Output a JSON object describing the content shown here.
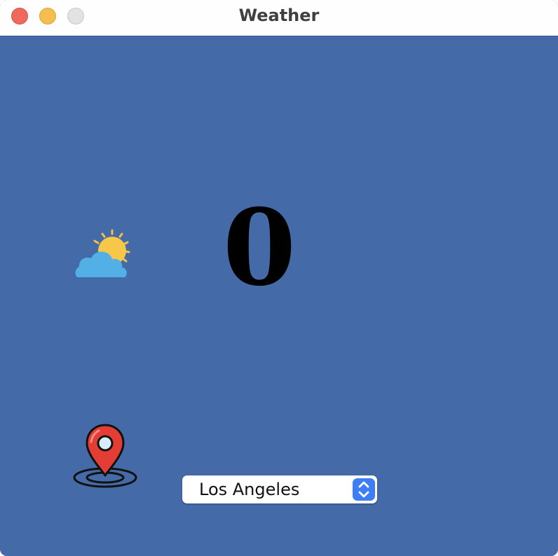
{
  "window": {
    "title": "Weather"
  },
  "weather": {
    "condition_icon": "partly-cloudy-icon",
    "temperature": "0"
  },
  "location": {
    "icon": "map-pin-icon",
    "selected_city": "Los Angeles"
  },
  "colors": {
    "background": "#446ba8",
    "close": "#ee6a5e",
    "minimize": "#f5be4f",
    "zoom": "#e2e2e2",
    "select_accent": "#3d7ef6"
  }
}
